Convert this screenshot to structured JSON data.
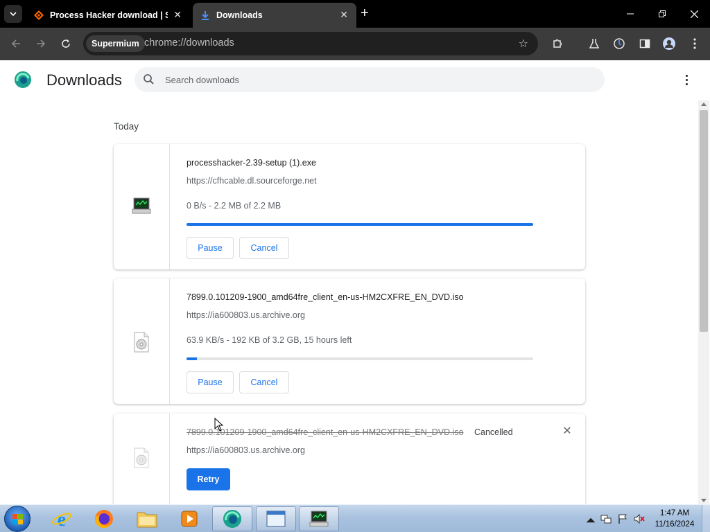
{
  "browser": {
    "tabs": [
      {
        "title": "Process Hacker download | SourceForge.net",
        "active": false
      },
      {
        "title": "Downloads",
        "active": true
      }
    ],
    "new_tab_label": "+",
    "profile_chip": "Supermium",
    "url": "chrome://downloads",
    "colors": {
      "tabstrip": "#000000",
      "toolbar": "#3c3c3c",
      "accent": "#1a73e8"
    }
  },
  "page": {
    "title": "Downloads",
    "search_placeholder": "Search downloads",
    "section": "Today",
    "downloads": [
      {
        "filename": "processhacker-2.39-setup (1).exe",
        "source": "https://cfhcable.dl.sourceforge.net",
        "status": "0 B/s - 2.2 MB of 2.2 MB",
        "progress": 1.0,
        "buttons": [
          "Pause",
          "Cancel"
        ],
        "icon": "process-hacker-app-icon"
      },
      {
        "filename": "7899.0.101209-1900_amd64fre_client_en-us-HM2CXFRE_EN_DVD.iso",
        "source": "https://ia600803.us.archive.org",
        "status": "63.9 KB/s - 192 KB of 3.2 GB, 15 hours left",
        "progress": 0.03,
        "buttons": [
          "Pause",
          "Cancel"
        ],
        "icon": "disc-image-file-icon"
      },
      {
        "filename": "7899.0.101209-1900_amd64fre_client_en-us-HM2CXFRE_EN_DVD.iso",
        "source": "https://ia600803.us.archive.org",
        "state": "Cancelled",
        "buttons": [
          "Retry"
        ],
        "icon": "disc-image-file-icon"
      }
    ]
  },
  "taskbar": {
    "apps": [
      "internet-explorer",
      "firefox",
      "file-explorer",
      "media-player",
      "supermium",
      "window",
      "process-hacker"
    ],
    "clock_time": "1:47 AM",
    "clock_date": "11/16/2024"
  }
}
